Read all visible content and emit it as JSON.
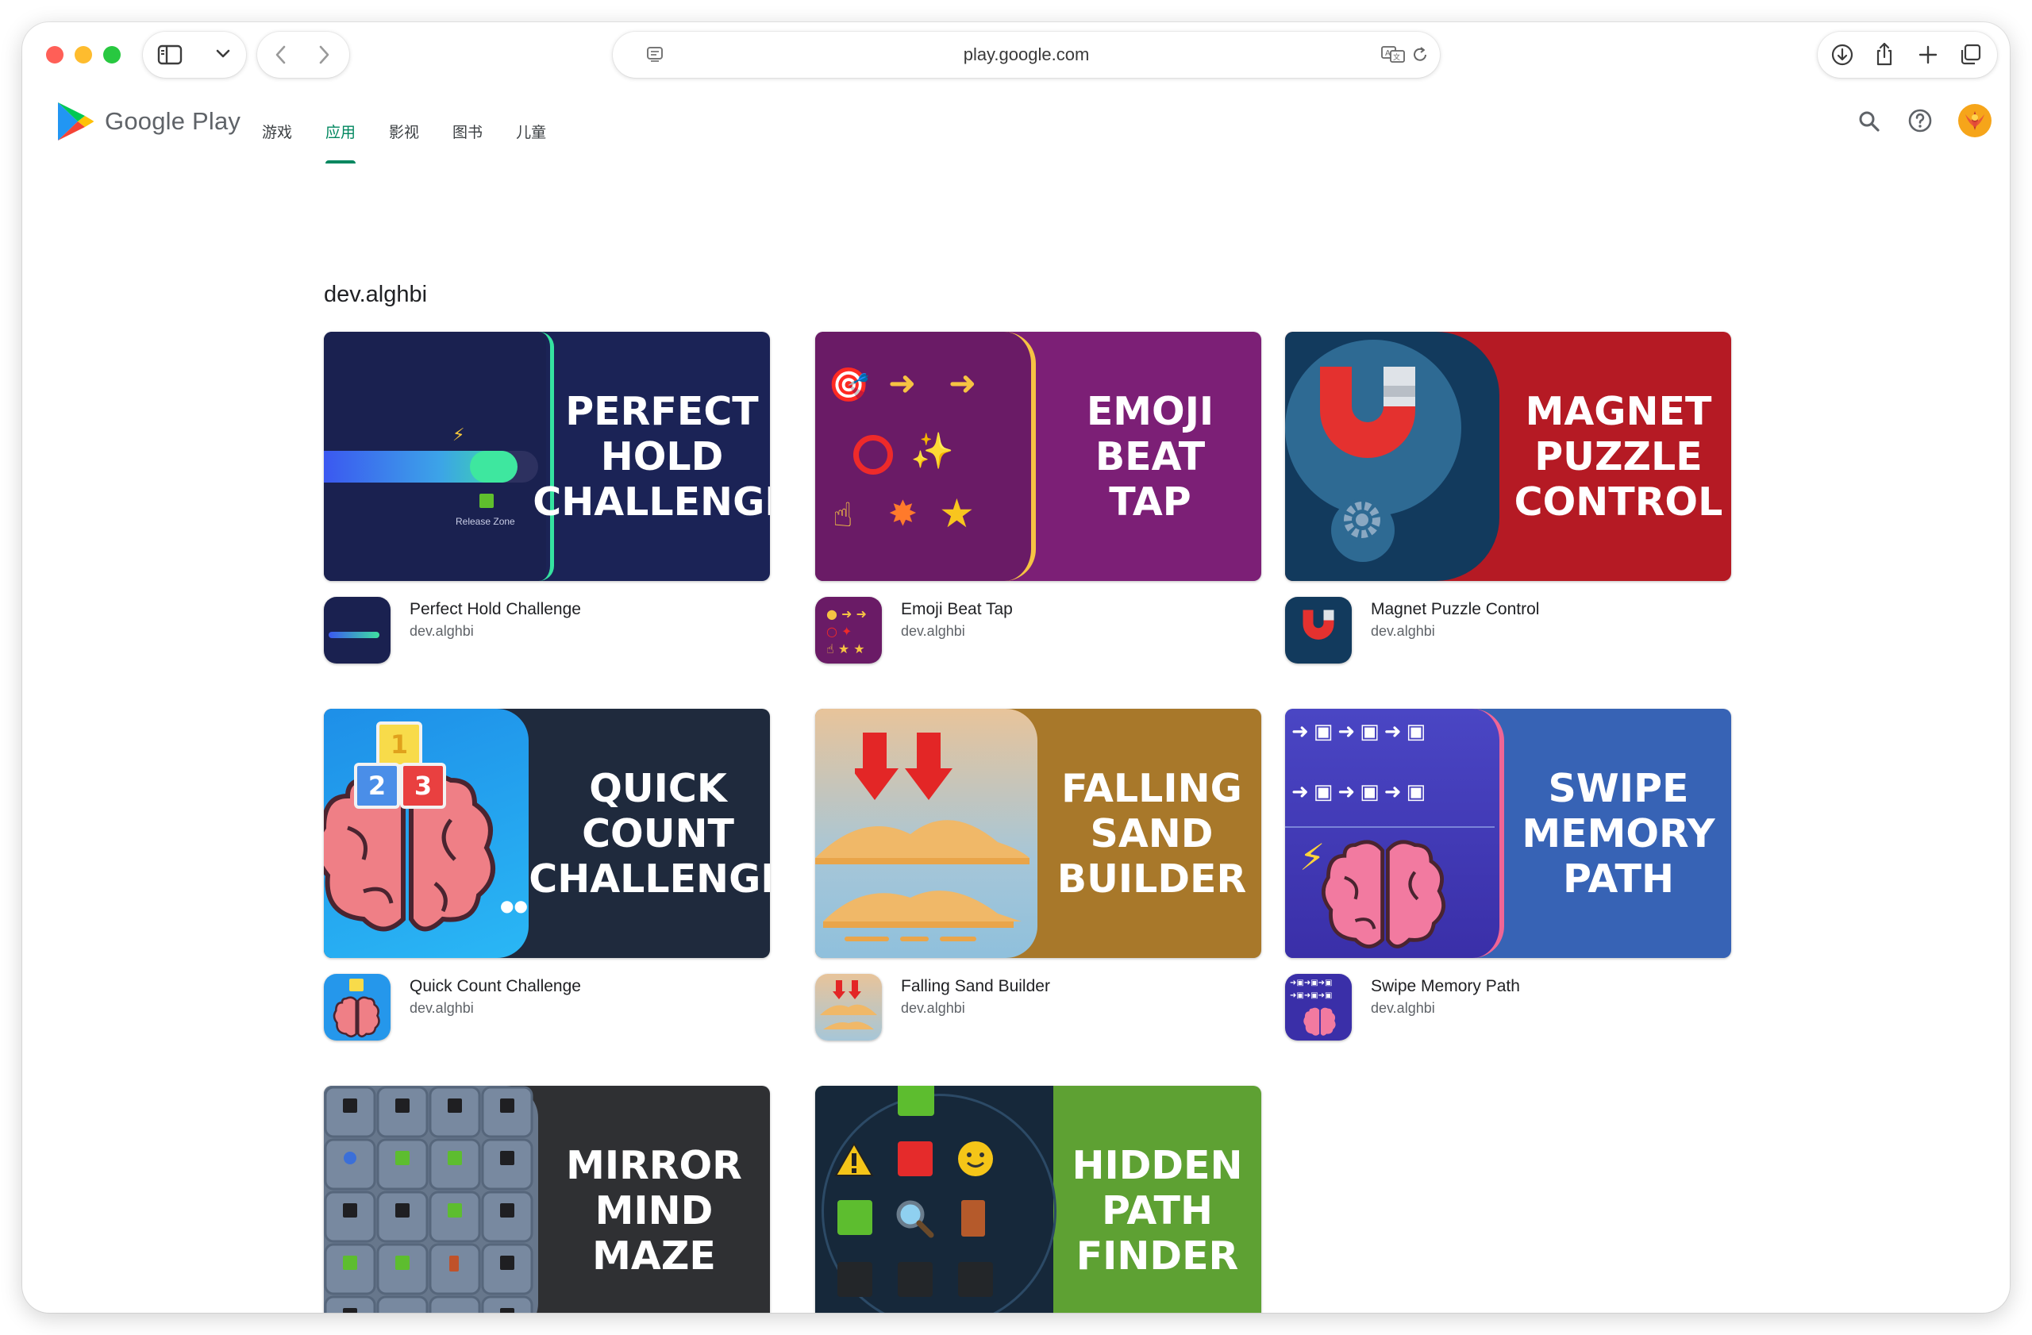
{
  "browser": {
    "url": "play.google.com"
  },
  "header": {
    "brand": "Google Play",
    "nav": [
      {
        "label": "游戏",
        "active": false
      },
      {
        "label": "应用",
        "active": true
      },
      {
        "label": "影视",
        "active": false
      },
      {
        "label": "图书",
        "active": false
      },
      {
        "label": "儿童",
        "active": false
      }
    ],
    "accent_color": "#01875f"
  },
  "developer": "dev.alghbi",
  "apps": [
    {
      "name": "Perfect Hold Challenge",
      "developer": "dev.alghbi",
      "banner_lines": [
        "PERFECT",
        "HOLD",
        "CHALLENGE"
      ],
      "banner_color": "#1b2356",
      "art_small_text": "Release Zone"
    },
    {
      "name": "Emoji Beat Tap",
      "developer": "dev.alghbi",
      "banner_lines": [
        "EMOJI",
        "BEAT",
        "TAP"
      ],
      "banner_color": "#7c1f76"
    },
    {
      "name": "Magnet Puzzle Control",
      "developer": "dev.alghbi",
      "banner_lines": [
        "MAGNET",
        "PUZZLE",
        "CONTROL"
      ],
      "banner_color": "#b51a24"
    },
    {
      "name": "Quick Count Challenge",
      "developer": "dev.alghbi",
      "banner_lines": [
        "QUICK",
        "COUNT",
        "CHALLENGE"
      ],
      "banner_color": "#1f2a3d"
    },
    {
      "name": "Falling Sand Builder",
      "developer": "dev.alghbi",
      "banner_lines": [
        "FALLING",
        "SAND",
        "BUILDER"
      ],
      "banner_color": "#a8782a"
    },
    {
      "name": "Swipe Memory Path",
      "developer": "dev.alghbi",
      "banner_lines": [
        "SWIPE",
        "MEMORY",
        "PATH"
      ],
      "banner_color": "#3763b5"
    },
    {
      "name": "Mirror Mind Maze",
      "developer": "dev.alghbi",
      "banner_lines": [
        "MIRROR",
        "MIND",
        "MAZE"
      ],
      "banner_color": "#2f3033"
    },
    {
      "name": "Hidden Path Finder",
      "developer": "dev.alghbi",
      "banner_lines": [
        "HIDDEN",
        "PATH",
        "FINDER"
      ],
      "banner_color": "#5ea133"
    }
  ]
}
